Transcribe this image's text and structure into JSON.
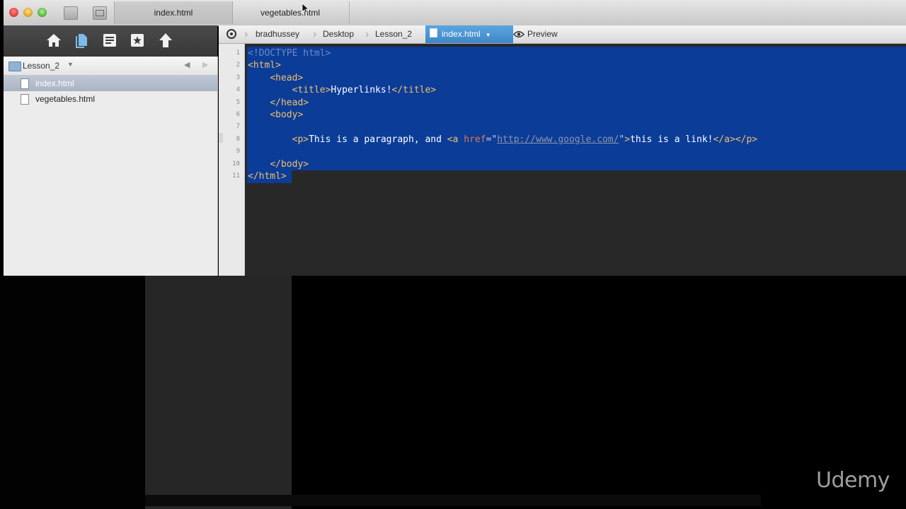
{
  "window": {
    "tabs": [
      {
        "label": "index.html",
        "active": true
      },
      {
        "label": "vegetables.html",
        "active": false
      }
    ]
  },
  "sidebar": {
    "toolbar_icons": [
      "home-icon",
      "files-icon",
      "outline-icon",
      "bookmark-icon",
      "publish-icon"
    ],
    "folder": "Lesson_2",
    "files": [
      {
        "label": "index.html",
        "selected": true
      },
      {
        "label": "vegetables.html",
        "selected": false
      }
    ]
  },
  "breadcrumb": {
    "items": [
      "bradhussey",
      "Desktop",
      "Lesson_2"
    ],
    "current": "index.html",
    "preview": "Preview"
  },
  "editor": {
    "line_numbers": [
      "1",
      "2",
      "3",
      "4",
      "5",
      "6",
      "7",
      "8",
      "9",
      "10",
      "11"
    ],
    "lines": [
      [
        {
          "t": "<!DOCTYPE html>",
          "c": "doc"
        }
      ],
      [
        {
          "t": "<html>",
          "c": "tag"
        }
      ],
      [
        {
          "t": "    ",
          "c": "txt"
        },
        {
          "t": "<head>",
          "c": "tag"
        }
      ],
      [
        {
          "t": "        ",
          "c": "txt"
        },
        {
          "t": "<title>",
          "c": "tag"
        },
        {
          "t": "Hyperlinks!",
          "c": "txt"
        },
        {
          "t": "</title>",
          "c": "tag"
        }
      ],
      [
        {
          "t": "    ",
          "c": "txt"
        },
        {
          "t": "</head>",
          "c": "tag"
        }
      ],
      [
        {
          "t": "    ",
          "c": "txt"
        },
        {
          "t": "<body>",
          "c": "tag"
        }
      ],
      [
        {
          "t": "",
          "c": "txt"
        }
      ],
      [
        {
          "t": "        ",
          "c": "txt"
        },
        {
          "t": "<p>",
          "c": "tag"
        },
        {
          "t": "This is a paragraph, and ",
          "c": "txt"
        },
        {
          "t": "<a ",
          "c": "tag"
        },
        {
          "t": "href",
          "c": "attr"
        },
        {
          "t": "=\"",
          "c": "str"
        },
        {
          "t": "http://www.google.com/",
          "c": "url"
        },
        {
          "t": "\"",
          "c": "str"
        },
        {
          "t": ">",
          "c": "tag"
        },
        {
          "t": "this is a link!",
          "c": "txt"
        },
        {
          "t": "</a></p>",
          "c": "tag"
        }
      ],
      [
        {
          "t": "",
          "c": "txt"
        }
      ],
      [
        {
          "t": "    ",
          "c": "txt"
        },
        {
          "t": "</body>",
          "c": "tag"
        }
      ],
      [
        {
          "t": "</html>",
          "c": "tag"
        }
      ]
    ]
  },
  "watermark": "Udemy"
}
